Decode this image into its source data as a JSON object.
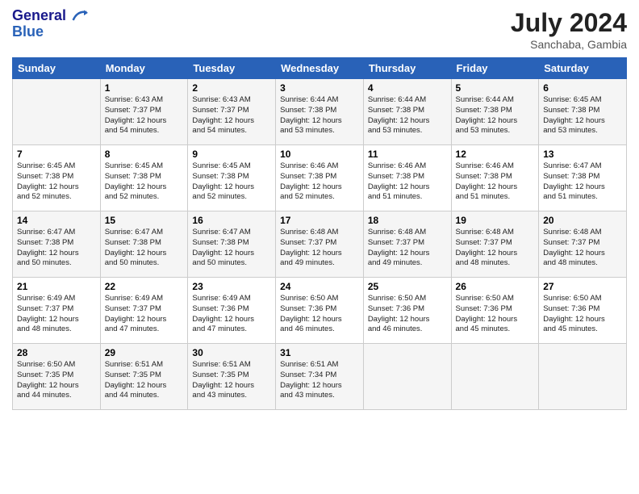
{
  "logo": {
    "line1": "General",
    "line2": "Blue"
  },
  "header": {
    "month_year": "July 2024",
    "location": "Sanchaba, Gambia"
  },
  "days_of_week": [
    "Sunday",
    "Monday",
    "Tuesday",
    "Wednesday",
    "Thursday",
    "Friday",
    "Saturday"
  ],
  "weeks": [
    [
      {
        "day": "",
        "content": ""
      },
      {
        "day": "1",
        "content": "Sunrise: 6:43 AM\nSunset: 7:37 PM\nDaylight: 12 hours\nand 54 minutes."
      },
      {
        "day": "2",
        "content": "Sunrise: 6:43 AM\nSunset: 7:37 PM\nDaylight: 12 hours\nand 54 minutes."
      },
      {
        "day": "3",
        "content": "Sunrise: 6:44 AM\nSunset: 7:38 PM\nDaylight: 12 hours\nand 53 minutes."
      },
      {
        "day": "4",
        "content": "Sunrise: 6:44 AM\nSunset: 7:38 PM\nDaylight: 12 hours\nand 53 minutes."
      },
      {
        "day": "5",
        "content": "Sunrise: 6:44 AM\nSunset: 7:38 PM\nDaylight: 12 hours\nand 53 minutes."
      },
      {
        "day": "6",
        "content": "Sunrise: 6:45 AM\nSunset: 7:38 PM\nDaylight: 12 hours\nand 53 minutes."
      }
    ],
    [
      {
        "day": "7",
        "content": "Sunrise: 6:45 AM\nSunset: 7:38 PM\nDaylight: 12 hours\nand 52 minutes."
      },
      {
        "day": "8",
        "content": "Sunrise: 6:45 AM\nSunset: 7:38 PM\nDaylight: 12 hours\nand 52 minutes."
      },
      {
        "day": "9",
        "content": "Sunrise: 6:45 AM\nSunset: 7:38 PM\nDaylight: 12 hours\nand 52 minutes."
      },
      {
        "day": "10",
        "content": "Sunrise: 6:46 AM\nSunset: 7:38 PM\nDaylight: 12 hours\nand 52 minutes."
      },
      {
        "day": "11",
        "content": "Sunrise: 6:46 AM\nSunset: 7:38 PM\nDaylight: 12 hours\nand 51 minutes."
      },
      {
        "day": "12",
        "content": "Sunrise: 6:46 AM\nSunset: 7:38 PM\nDaylight: 12 hours\nand 51 minutes."
      },
      {
        "day": "13",
        "content": "Sunrise: 6:47 AM\nSunset: 7:38 PM\nDaylight: 12 hours\nand 51 minutes."
      }
    ],
    [
      {
        "day": "14",
        "content": "Sunrise: 6:47 AM\nSunset: 7:38 PM\nDaylight: 12 hours\nand 50 minutes."
      },
      {
        "day": "15",
        "content": "Sunrise: 6:47 AM\nSunset: 7:38 PM\nDaylight: 12 hours\nand 50 minutes."
      },
      {
        "day": "16",
        "content": "Sunrise: 6:47 AM\nSunset: 7:38 PM\nDaylight: 12 hours\nand 50 minutes."
      },
      {
        "day": "17",
        "content": "Sunrise: 6:48 AM\nSunset: 7:37 PM\nDaylight: 12 hours\nand 49 minutes."
      },
      {
        "day": "18",
        "content": "Sunrise: 6:48 AM\nSunset: 7:37 PM\nDaylight: 12 hours\nand 49 minutes."
      },
      {
        "day": "19",
        "content": "Sunrise: 6:48 AM\nSunset: 7:37 PM\nDaylight: 12 hours\nand 48 minutes."
      },
      {
        "day": "20",
        "content": "Sunrise: 6:48 AM\nSunset: 7:37 PM\nDaylight: 12 hours\nand 48 minutes."
      }
    ],
    [
      {
        "day": "21",
        "content": "Sunrise: 6:49 AM\nSunset: 7:37 PM\nDaylight: 12 hours\nand 48 minutes."
      },
      {
        "day": "22",
        "content": "Sunrise: 6:49 AM\nSunset: 7:37 PM\nDaylight: 12 hours\nand 47 minutes."
      },
      {
        "day": "23",
        "content": "Sunrise: 6:49 AM\nSunset: 7:36 PM\nDaylight: 12 hours\nand 47 minutes."
      },
      {
        "day": "24",
        "content": "Sunrise: 6:50 AM\nSunset: 7:36 PM\nDaylight: 12 hours\nand 46 minutes."
      },
      {
        "day": "25",
        "content": "Sunrise: 6:50 AM\nSunset: 7:36 PM\nDaylight: 12 hours\nand 46 minutes."
      },
      {
        "day": "26",
        "content": "Sunrise: 6:50 AM\nSunset: 7:36 PM\nDaylight: 12 hours\nand 45 minutes."
      },
      {
        "day": "27",
        "content": "Sunrise: 6:50 AM\nSunset: 7:36 PM\nDaylight: 12 hours\nand 45 minutes."
      }
    ],
    [
      {
        "day": "28",
        "content": "Sunrise: 6:50 AM\nSunset: 7:35 PM\nDaylight: 12 hours\nand 44 minutes."
      },
      {
        "day": "29",
        "content": "Sunrise: 6:51 AM\nSunset: 7:35 PM\nDaylight: 12 hours\nand 44 minutes."
      },
      {
        "day": "30",
        "content": "Sunrise: 6:51 AM\nSunset: 7:35 PM\nDaylight: 12 hours\nand 43 minutes."
      },
      {
        "day": "31",
        "content": "Sunrise: 6:51 AM\nSunset: 7:34 PM\nDaylight: 12 hours\nand 43 minutes."
      },
      {
        "day": "",
        "content": ""
      },
      {
        "day": "",
        "content": ""
      },
      {
        "day": "",
        "content": ""
      }
    ]
  ]
}
